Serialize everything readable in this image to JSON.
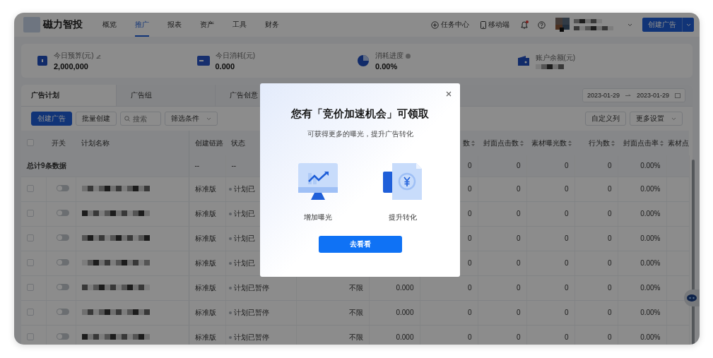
{
  "header": {
    "logo_text": "磁力智投",
    "nav": [
      {
        "label": "概览",
        "selected": false
      },
      {
        "label": "推广",
        "selected": true
      },
      {
        "label": "报表",
        "selected": false
      },
      {
        "label": "资产",
        "selected": false
      },
      {
        "label": "工具",
        "selected": false
      },
      {
        "label": "财务",
        "selected": false
      }
    ],
    "links": [
      {
        "kind": "task",
        "label": "任务中心"
      },
      {
        "kind": "mobile",
        "label": "移动端"
      }
    ],
    "notification_dot": true,
    "create_button": "创建广告"
  },
  "stats": [
    {
      "kind": "budget",
      "label": "今日预算(元)",
      "value": "2,000,000",
      "editable": true
    },
    {
      "kind": "cost",
      "label": "今日消耗(元)",
      "value": "0.000"
    },
    {
      "kind": "progress",
      "label": "消耗进度",
      "value": "0.00%",
      "help": true
    },
    {
      "kind": "balance",
      "label": "账户余额(元)"
    }
  ],
  "tabs": [
    {
      "label": "广告计划",
      "selected": true
    },
    {
      "label": "广告组",
      "selected": false
    },
    {
      "label": "广告创意",
      "selected": false
    }
  ],
  "date_range": {
    "start": "2023-01-29",
    "end": "2023-01-29"
  },
  "toolbar": {
    "create": "创建广告",
    "batch": "批量创建",
    "search_placeholder": "搜索",
    "filter": "筛选条件",
    "custom_columns": "自定义列",
    "more": "更多设置"
  },
  "table": {
    "columns": [
      {
        "label": "开关"
      },
      {
        "label": "计划名称"
      },
      {
        "label": "创建链路"
      },
      {
        "label": "状态"
      },
      {},
      {},
      {
        "label": "数",
        "sortable": true
      },
      {
        "label": "封面点击数",
        "sortable": true
      },
      {
        "label": "素材曝光数",
        "sortable": true
      },
      {
        "label": "行为数",
        "sortable": true
      },
      {
        "label": "封面点击率",
        "sortable": true
      },
      {
        "label": "素材点"
      }
    ],
    "header_checked": false,
    "total": {
      "label": "总计9条数据",
      "link": "--",
      "status": "--",
      "metrics": [
        "0",
        "0",
        "0",
        "0",
        "0.00%"
      ]
    },
    "rows": [
      {
        "checked": false,
        "on": false,
        "link": "标准版",
        "status": "计划已",
        "metrics": [
          "0",
          "0",
          "0",
          "0",
          "0.00%"
        ]
      },
      {
        "checked": false,
        "on": false,
        "link": "标准版",
        "status": "计划已",
        "metrics": [
          "0",
          "0",
          "0",
          "0",
          "0.00%"
        ]
      },
      {
        "checked": false,
        "on": false,
        "link": "标准版",
        "status": "计划已",
        "metrics": [
          "0",
          "0",
          "0",
          "0",
          "0.00%"
        ]
      },
      {
        "checked": false,
        "on": false,
        "link": "标准版",
        "status": "计划已",
        "metrics": [
          "0",
          "0",
          "0",
          "0",
          "0.00%"
        ]
      },
      {
        "checked": false,
        "on": false,
        "link": "标准版",
        "status": "计划已暂停",
        "budget": "不限",
        "cost": "0.000",
        "metrics": [
          "0",
          "0",
          "0",
          "0",
          "0.00%"
        ]
      },
      {
        "checked": false,
        "on": false,
        "link": "标准版",
        "status": "计划已暂停",
        "budget": "不限",
        "cost": "0.000",
        "metrics": [
          "0",
          "0",
          "0",
          "0",
          "0.00%"
        ]
      },
      {
        "checked": false,
        "on": false,
        "link": "标准版",
        "status": "计划已暂停",
        "budget": "不限",
        "cost": "0.000",
        "metrics": [
          "0",
          "0",
          "0",
          "0",
          "0.00%"
        ]
      }
    ]
  },
  "modal": {
    "title": "您有「竞价加速机会」可领取",
    "subtitle": "可获得更多的曝光，提升广告转化",
    "features": [
      {
        "kind": "exposure",
        "label": "增加曝光"
      },
      {
        "kind": "conversion",
        "label": "提升转化"
      }
    ],
    "button": "去看看"
  }
}
